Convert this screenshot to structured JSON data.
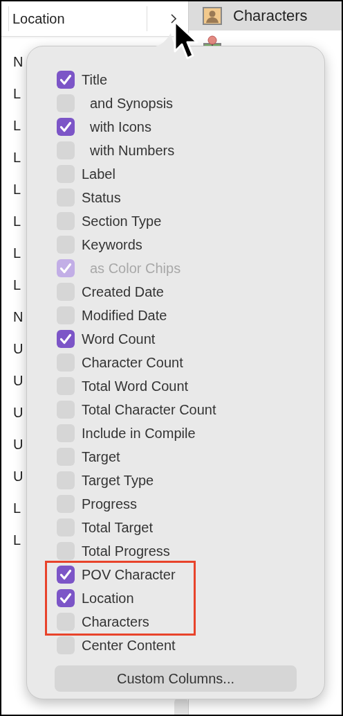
{
  "table": {
    "header": "Location",
    "rows": [
      "N",
      "L",
      "L",
      "L",
      "L",
      "L",
      "L",
      "L",
      "N",
      "U",
      "U",
      "U",
      "U",
      "U",
      "L",
      "L"
    ]
  },
  "sidebar": {
    "items": [
      {
        "label": "Characters",
        "kind": "person",
        "selected": true
      },
      {
        "kind": "pin",
        "selected": false
      }
    ]
  },
  "popover": {
    "items": [
      {
        "label": "Title",
        "checked": true,
        "disabled": false,
        "highlighted": false,
        "children": [
          {
            "label": "and Synopsis",
            "checked": false,
            "disabled": false
          },
          {
            "label": "with Icons",
            "checked": true,
            "disabled": false
          },
          {
            "label": "with Numbers",
            "checked": false,
            "disabled": false
          }
        ]
      },
      {
        "label": "Label",
        "checked": false,
        "disabled": false,
        "highlighted": false
      },
      {
        "label": "Status",
        "checked": false,
        "disabled": false,
        "highlighted": false
      },
      {
        "label": "Section Type",
        "checked": false,
        "disabled": false,
        "highlighted": false
      },
      {
        "label": "Keywords",
        "checked": false,
        "disabled": false,
        "highlighted": false,
        "children": [
          {
            "label": "as Color Chips",
            "checked": true,
            "disabled": true
          }
        ]
      },
      {
        "label": "Created Date",
        "checked": false,
        "disabled": false,
        "highlighted": false
      },
      {
        "label": "Modified Date",
        "checked": false,
        "disabled": false,
        "highlighted": false
      },
      {
        "label": "Word Count",
        "checked": true,
        "disabled": false,
        "highlighted": false
      },
      {
        "label": "Character Count",
        "checked": false,
        "disabled": false,
        "highlighted": false
      },
      {
        "label": "Total Word Count",
        "checked": false,
        "disabled": false,
        "highlighted": false
      },
      {
        "label": "Total Character Count",
        "checked": false,
        "disabled": false,
        "highlighted": false
      },
      {
        "label": "Include in Compile",
        "checked": false,
        "disabled": false,
        "highlighted": false
      },
      {
        "label": "Target",
        "checked": false,
        "disabled": false,
        "highlighted": false
      },
      {
        "label": "Target Type",
        "checked": false,
        "disabled": false,
        "highlighted": false
      },
      {
        "label": "Progress",
        "checked": false,
        "disabled": false,
        "highlighted": false
      },
      {
        "label": "Total Target",
        "checked": false,
        "disabled": false,
        "highlighted": false
      },
      {
        "label": "Total Progress",
        "checked": false,
        "disabled": false,
        "highlighted": false
      },
      {
        "label": "POV Character",
        "checked": true,
        "disabled": false,
        "highlighted": true
      },
      {
        "label": "Location",
        "checked": true,
        "disabled": false,
        "highlighted": true
      },
      {
        "label": "Characters",
        "checked": false,
        "disabled": false,
        "highlighted": true
      },
      {
        "label": "Center Content",
        "checked": false,
        "disabled": false,
        "highlighted": false
      }
    ],
    "button": "Custom Columns..."
  }
}
